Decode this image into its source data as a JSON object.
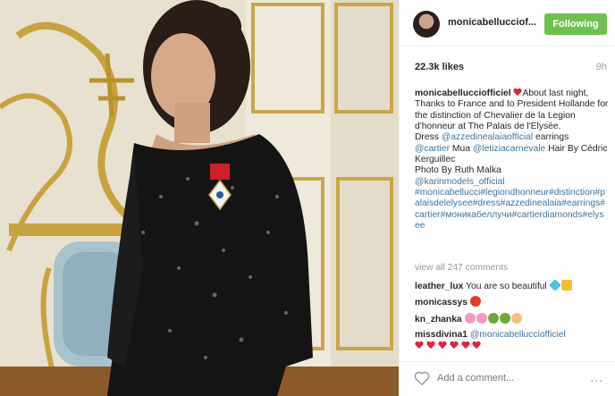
{
  "header": {
    "username": "monicabellucciof...",
    "follow_label": "Following"
  },
  "post": {
    "likes": "22.3k likes",
    "time": "9h",
    "caption_user": "monicabelluccio​fficiel",
    "caption_lines": [
      "About last night, Thanks to France and to President Hollande for the distinction of Chevalier de la Legion d'honneur at The Palais de l'Elysée.",
      "Dress ",
      "@azzedinealaiaofficial",
      " earrings",
      "@cartier",
      " Mua ",
      "@letiziacarnevale",
      " Hair By Cédric Kerguillec",
      "Photo By Ruth Malka",
      "@karinmodels_official",
      "#monicabellucci#legiondhonneur#distinction#palaisdelelysee#dress#azzedinealaia#earrings#cartier#моникабеллучи#cartierdiamonds#elysee"
    ]
  },
  "comments": {
    "view_all": "view all 247 comments",
    "items": [
      {
        "user": "leather_lux",
        "text": "You are so beautiful"
      },
      {
        "user": "monicassys",
        "text": ""
      },
      {
        "user": "kn_zhanka",
        "text": ""
      },
      {
        "user": "missdivina1",
        "text": "@monicabelluccio​fficiel"
      }
    ]
  },
  "footer": {
    "placeholder": "Add a comment...",
    "more": "..."
  },
  "colors": {
    "follow": "#70c050",
    "link": "#3f729b",
    "heart": "#e0223c"
  }
}
